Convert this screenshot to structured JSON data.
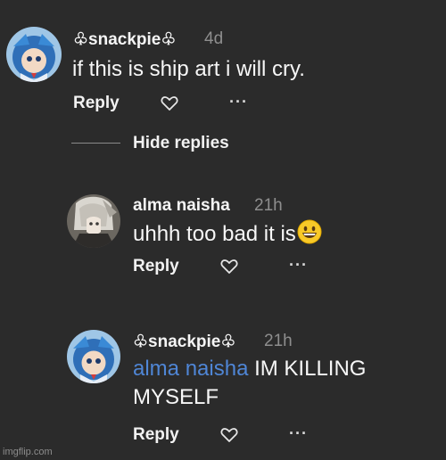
{
  "comments": [
    {
      "username": "♧snackpie♧",
      "time": "4d",
      "text": "if this is ship art i will cry.",
      "reply_label": "Reply",
      "more_label": "···"
    },
    {
      "username": "alma naisha",
      "time": "21h",
      "text": "uhhh too bad it is",
      "emoji": "grinning-face",
      "reply_label": "Reply",
      "more_label": "···"
    },
    {
      "username": "♧snackpie♧",
      "time": "21h",
      "mention": "alma naisha",
      "text_line1": " IM KILLING",
      "text_line2": "MYSELF",
      "reply_label": "Reply",
      "more_label": "···"
    }
  ],
  "thread": {
    "hide_replies_label": "Hide replies"
  },
  "watermark": "imgflip.com",
  "colors": {
    "background": "#2b2b2b",
    "mention": "#4f86d6",
    "timestamp": "#8e8e8e",
    "text": "#f7f7f7"
  }
}
